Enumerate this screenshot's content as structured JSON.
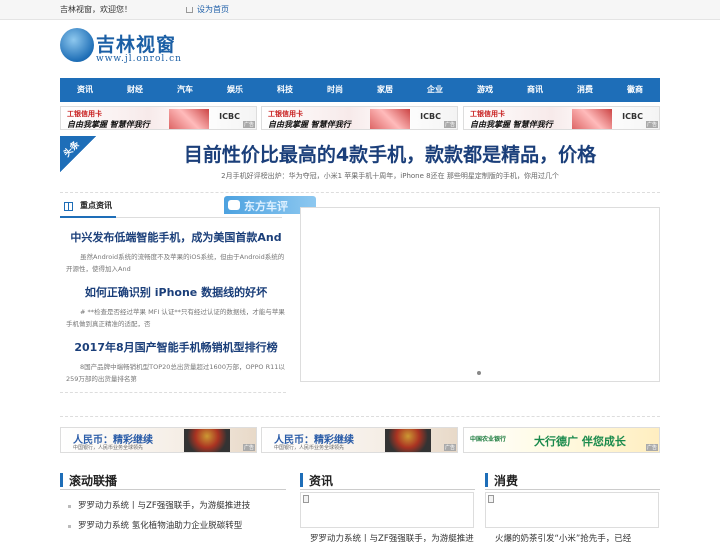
{
  "topbar": {
    "welcome": "吉林视窗，欢迎您！",
    "set_home": "设为首页"
  },
  "logo": {
    "name": "吉林视窗",
    "url": "www.jl.onrol.cn"
  },
  "nav": [
    "资讯",
    "财经",
    "汽车",
    "娱乐",
    "科技",
    "时尚",
    "家居",
    "企业",
    "游戏",
    "商讯",
    "消费",
    "徽商"
  ],
  "banner_ad": {
    "line1": "工银信用卡",
    "line2": "自由我掌握 智慧伴我行",
    "brand": "ICBC",
    "ad_tag": "广告"
  },
  "headline": {
    "tag": "头条",
    "title": "目前性价比最高的4款手机，款款都是精品，价格",
    "summary": "2月手机好评榜出炉：华为夺冠，小米1 苹果手机十周年，iPhone 8还在 那些明星定制版的手机，你用过几个"
  },
  "focus": {
    "title": "重点资讯",
    "slide_peek": "东方车评",
    "items": [
      {
        "title": "中兴发布低端智能手机，成为美国首款And",
        "desc": "虽然Android系统的流畅度不及苹果的iOS系统，但由于Android系统的开源性，使得加入And"
      },
      {
        "title": "如何正确识别 iPhone 数据线的好坏",
        "desc": "# **检查是否经过苹果 MFI 认证**只有经过认证的数据线，才能与苹果手机做到真正精准的适配，否"
      },
      {
        "title": "2017年8月国产智能手机畅销机型排行榜",
        "desc": "8国产品牌中端畅销机型TOP20总出货量超过1600万部，OPPO R11以259万部的出货量排名第"
      }
    ]
  },
  "banners2": {
    "rmb_title": "人民币：精彩继续",
    "rmb_sub": "中国银行，人民币业务全球领先",
    "abc_name": "中国农业银行",
    "abc_slogan": "大行德广 伴您成长",
    "ad_tag": "广告"
  },
  "columns": {
    "rolling": {
      "title": "滚动联播",
      "items": [
        "罗罗动力系统丨与ZF强强联手，为游艇推进技",
        "罗罗动力系统 氢化植物油助力企业脱碳转型"
      ]
    },
    "news": {
      "title": "资讯",
      "caption": "罗罗动力系统丨与ZF强强联手，为游艇推进"
    },
    "consume": {
      "title": "消费",
      "caption": "火爆的奶茶引发“小米”抢先手，已经"
    }
  }
}
